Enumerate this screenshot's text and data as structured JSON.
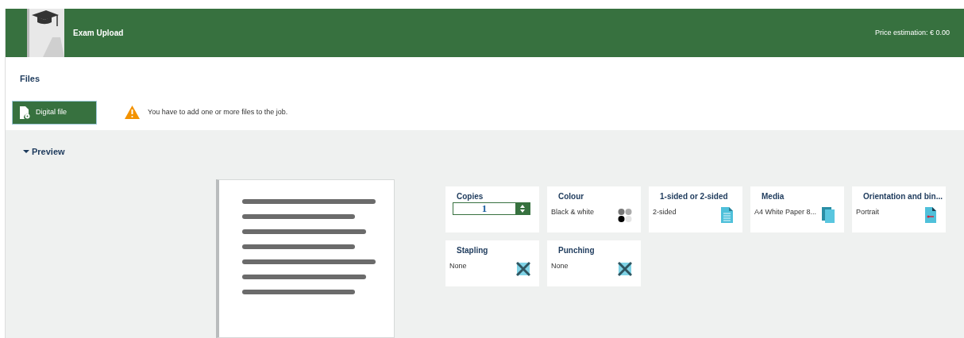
{
  "header": {
    "title": "Exam Upload",
    "price": "Price estimation: € 0.00"
  },
  "files": {
    "heading": "Files",
    "button": "Digital file",
    "warning": "You have to add one or more files to the job."
  },
  "preview": {
    "label": "Preview",
    "expanded": true
  },
  "settings": [
    {
      "kind": "stepper",
      "title": "Copies",
      "value": "1"
    },
    {
      "kind": "option",
      "title": "Colour",
      "value": "Black & white"
    },
    {
      "kind": "option",
      "title": "1-sided or 2-sided",
      "value": "2-sided"
    },
    {
      "kind": "option",
      "title": "Media",
      "value": "A4 White Paper 8..."
    },
    {
      "kind": "option",
      "title": "Orientation and bin...",
      "value": "Portrait"
    },
    {
      "kind": "option",
      "title": "Stapling",
      "value": "None"
    },
    {
      "kind": "option",
      "title": "Punching",
      "value": "None"
    }
  ]
}
